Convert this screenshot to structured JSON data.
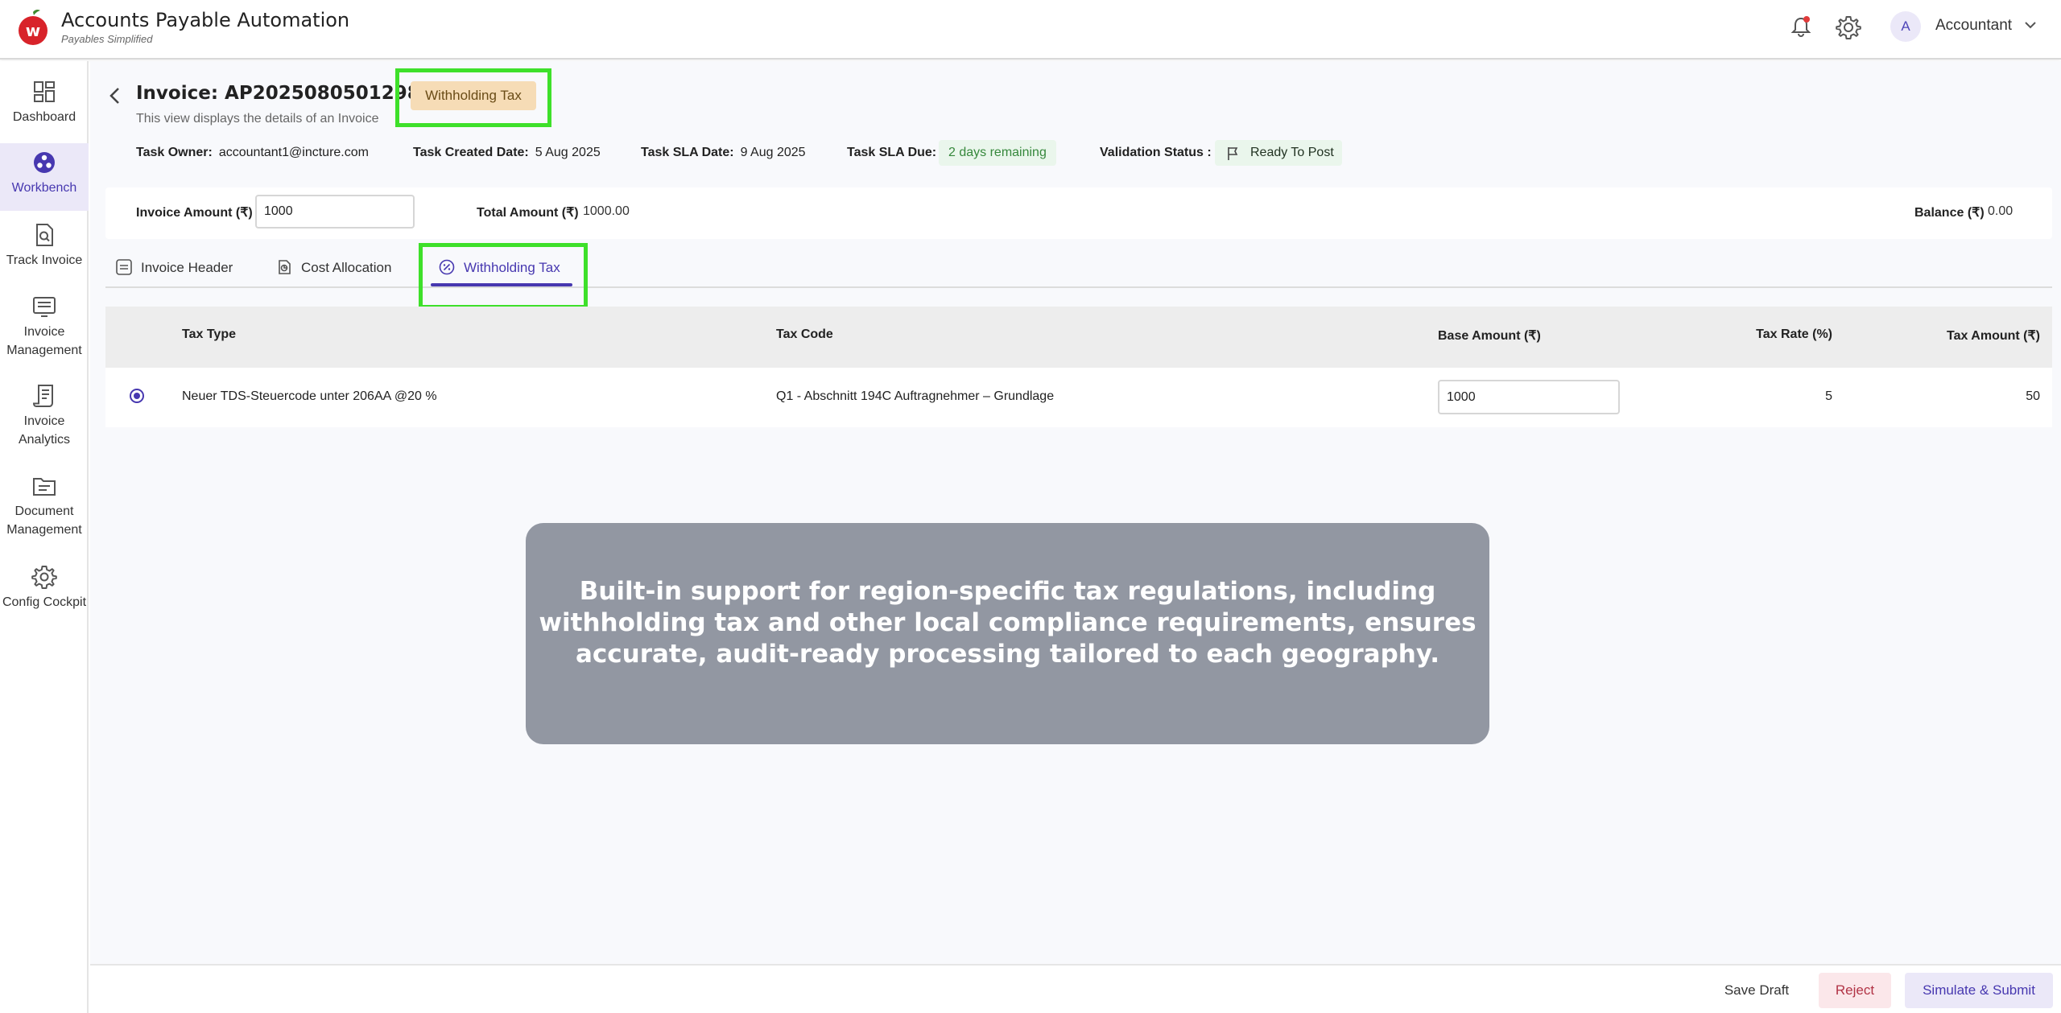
{
  "app": {
    "title": "Accounts Payable Automation",
    "subtitle": "Payables Simplified",
    "logo_letter": "w",
    "user_initial": "A",
    "user_role": "Accountant"
  },
  "sidebar": {
    "items": [
      {
        "label": "Dashboard",
        "icon": "dashboard-icon"
      },
      {
        "label": "Workbench",
        "icon": "workbench-icon",
        "active": true
      },
      {
        "label": "Track Invoice",
        "icon": "track-invoice-icon"
      },
      {
        "label": "Invoice Management",
        "icon": "invoice-management-icon"
      },
      {
        "label": "Invoice Analytics",
        "icon": "invoice-analytics-icon"
      },
      {
        "label": "Document Management",
        "icon": "document-management-icon"
      },
      {
        "label": "Config Cockpit",
        "icon": "config-icon"
      }
    ]
  },
  "invoice": {
    "title": "Invoice: AP20250805012988",
    "badge": "Withholding Tax",
    "description": "This view displays the details of an Invoice",
    "task_owner_label": "Task Owner:",
    "task_owner": "accountant1@incture.com",
    "task_created_label": "Task Created Date:",
    "task_created": "5 Aug 2025",
    "sla_date_label": "Task SLA Date:",
    "sla_date": "9 Aug 2025",
    "sla_due_label": "Task SLA Due:",
    "sla_due": "2 days remaining",
    "validation_label": "Validation Status :",
    "validation_status": "Ready To Post"
  },
  "amounts": {
    "invoice_amount_label": "Invoice Amount (₹)",
    "invoice_amount": "1000",
    "total_amount_label": "Total Amount (₹)",
    "total_amount": "1000.00",
    "balance_label": "Balance (₹)",
    "balance": "0.00"
  },
  "tabs": [
    {
      "label": "Invoice Header",
      "icon": "document-icon"
    },
    {
      "label": "Cost Allocation",
      "icon": "allocation-icon"
    },
    {
      "label": "Withholding Tax",
      "icon": "tax-icon",
      "active": true
    }
  ],
  "table": {
    "columns": [
      "Tax Type",
      "Tax Code",
      "Base Amount (₹)",
      "Tax Rate (%)",
      "Tax Amount (₹)"
    ],
    "rows": [
      {
        "selected": true,
        "tax_type": "Neuer TDS-Steuercode unter 206AA @20 %",
        "tax_code": "Q1 - Abschnitt 194C Auftragnehmer – Grundlage",
        "base_amount": "1000",
        "tax_rate": "5",
        "tax_amount": "50"
      }
    ]
  },
  "callout": {
    "line1": "Built-in support for region-specific tax regulations, including",
    "line2": "withholding tax and other local compliance requirements, ensures",
    "line3": "accurate, audit-ready processing tailored to each geography."
  },
  "footer": {
    "save_draft": "Save Draft",
    "reject": "Reject",
    "submit": "Simulate & Submit"
  },
  "colors": {
    "accent": "#4738b0",
    "highlight": "#3ee02a",
    "badge_bg": "#f6dcb6",
    "success_bg": "#eaf6ec",
    "reject_bg": "#fbe7ea",
    "callout_bg": "#9297a2"
  }
}
